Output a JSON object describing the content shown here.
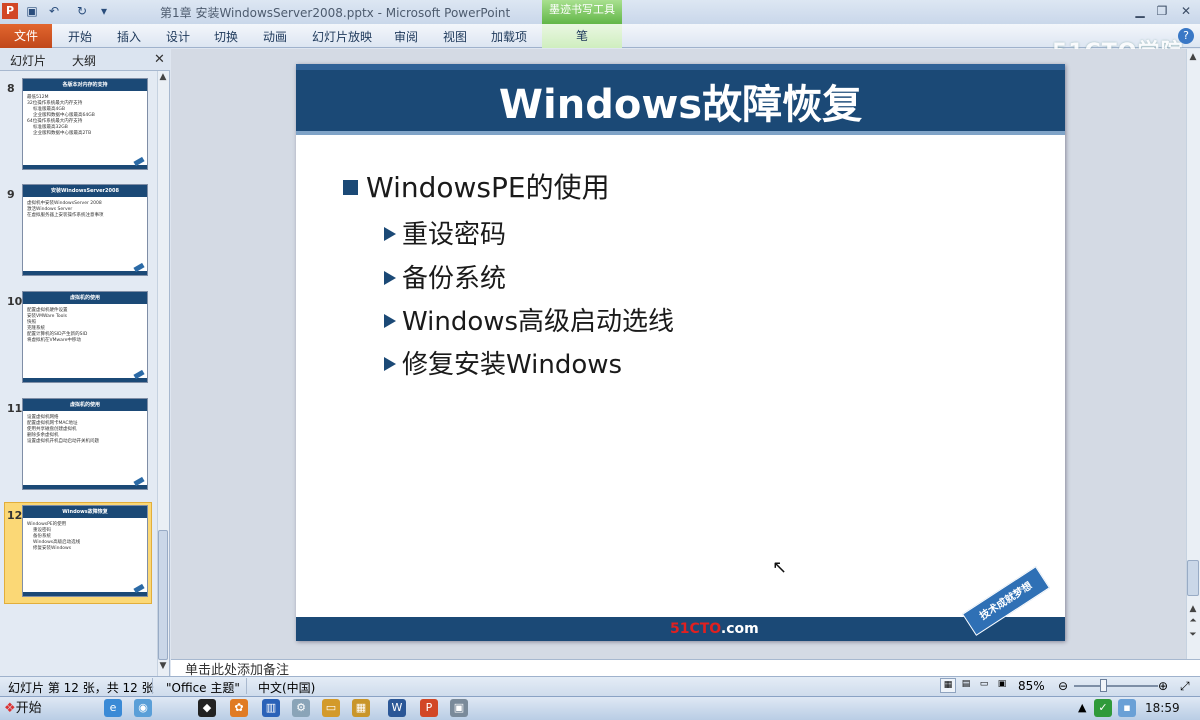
{
  "titlebar": {
    "doc_title": "第1章 安装WindowsServer2008.pptx - Microsoft PowerPoint",
    "context_tab": "墨迹书写工具",
    "app_icon": "P"
  },
  "ribbon": {
    "file": "文件",
    "tabs": [
      "开始",
      "插入",
      "设计",
      "切换",
      "动画",
      "幻灯片放映",
      "审阅",
      "视图",
      "加载项"
    ],
    "pen": "笔"
  },
  "watermark": "51CTO学院",
  "pane": {
    "tab_slides": "幻灯片",
    "tab_outline": "大纲"
  },
  "thumbnails": [
    {
      "num": "8",
      "title": "各版本对内存的支持",
      "lines": [
        "最低512M",
        "32位操作系统最大内存支持",
        "标准版最高4GB",
        "企业版和数据中心版最高64GB",
        "64位操作系统最大内存支持",
        "标准版最高32GB",
        "企业版和数据中心版最高2TB"
      ]
    },
    {
      "num": "9",
      "title": "安装WindowsServer2008",
      "lines": [
        "虚拟机中安装WindowsServer 2008",
        "激活Windows Server",
        "在虚拟服务器上安装操作系统注意事项"
      ]
    },
    {
      "num": "10",
      "title": "虚拟机的使用",
      "lines": [
        "配置虚拟机硬件设置",
        "安装VMWare Tools",
        "快照",
        "克隆系统",
        "配置计算机的SID产生新的SID",
        "将虚拟机在VMware中移动"
      ]
    },
    {
      "num": "11",
      "title": "虚拟机的使用",
      "lines": [
        "设置虚拟机网络",
        "配置虚拟机网卡MAC地址",
        "使用共享磁盘创建虚拟机",
        "删除多余虚拟机",
        "设置虚拟机开机自动启动开关机问题"
      ]
    },
    {
      "num": "12",
      "title": "Windows故障恢复",
      "lines": [
        "WindowsPE的使用",
        "重设密码",
        "备份系统",
        "Windows高级启动选线",
        "修复安装Windows"
      ]
    }
  ],
  "slide": {
    "title": "Windows故障恢复",
    "bullet": "WindowsPE的使用",
    "subbullets": [
      "重设密码",
      "备份系统",
      "Windows高级启动选线",
      "修复安装Windows"
    ],
    "footer_logo_red": "51CTO",
    "footer_logo_white": ".com",
    "tag": "技术成就梦想"
  },
  "notes": {
    "placeholder": "单击此处添加备注"
  },
  "status": {
    "slide_info": "幻灯片 第 12 张，共 12 张",
    "theme": "\"Office 主题\"",
    "language": "中文(中国)",
    "zoom": "85%"
  },
  "taskbar": {
    "start": "开始",
    "clock": "18:59"
  },
  "colors": {
    "slide_blue": "#1b4976",
    "file_tab": "#d24726",
    "selected_thumb": "#fbd876"
  }
}
